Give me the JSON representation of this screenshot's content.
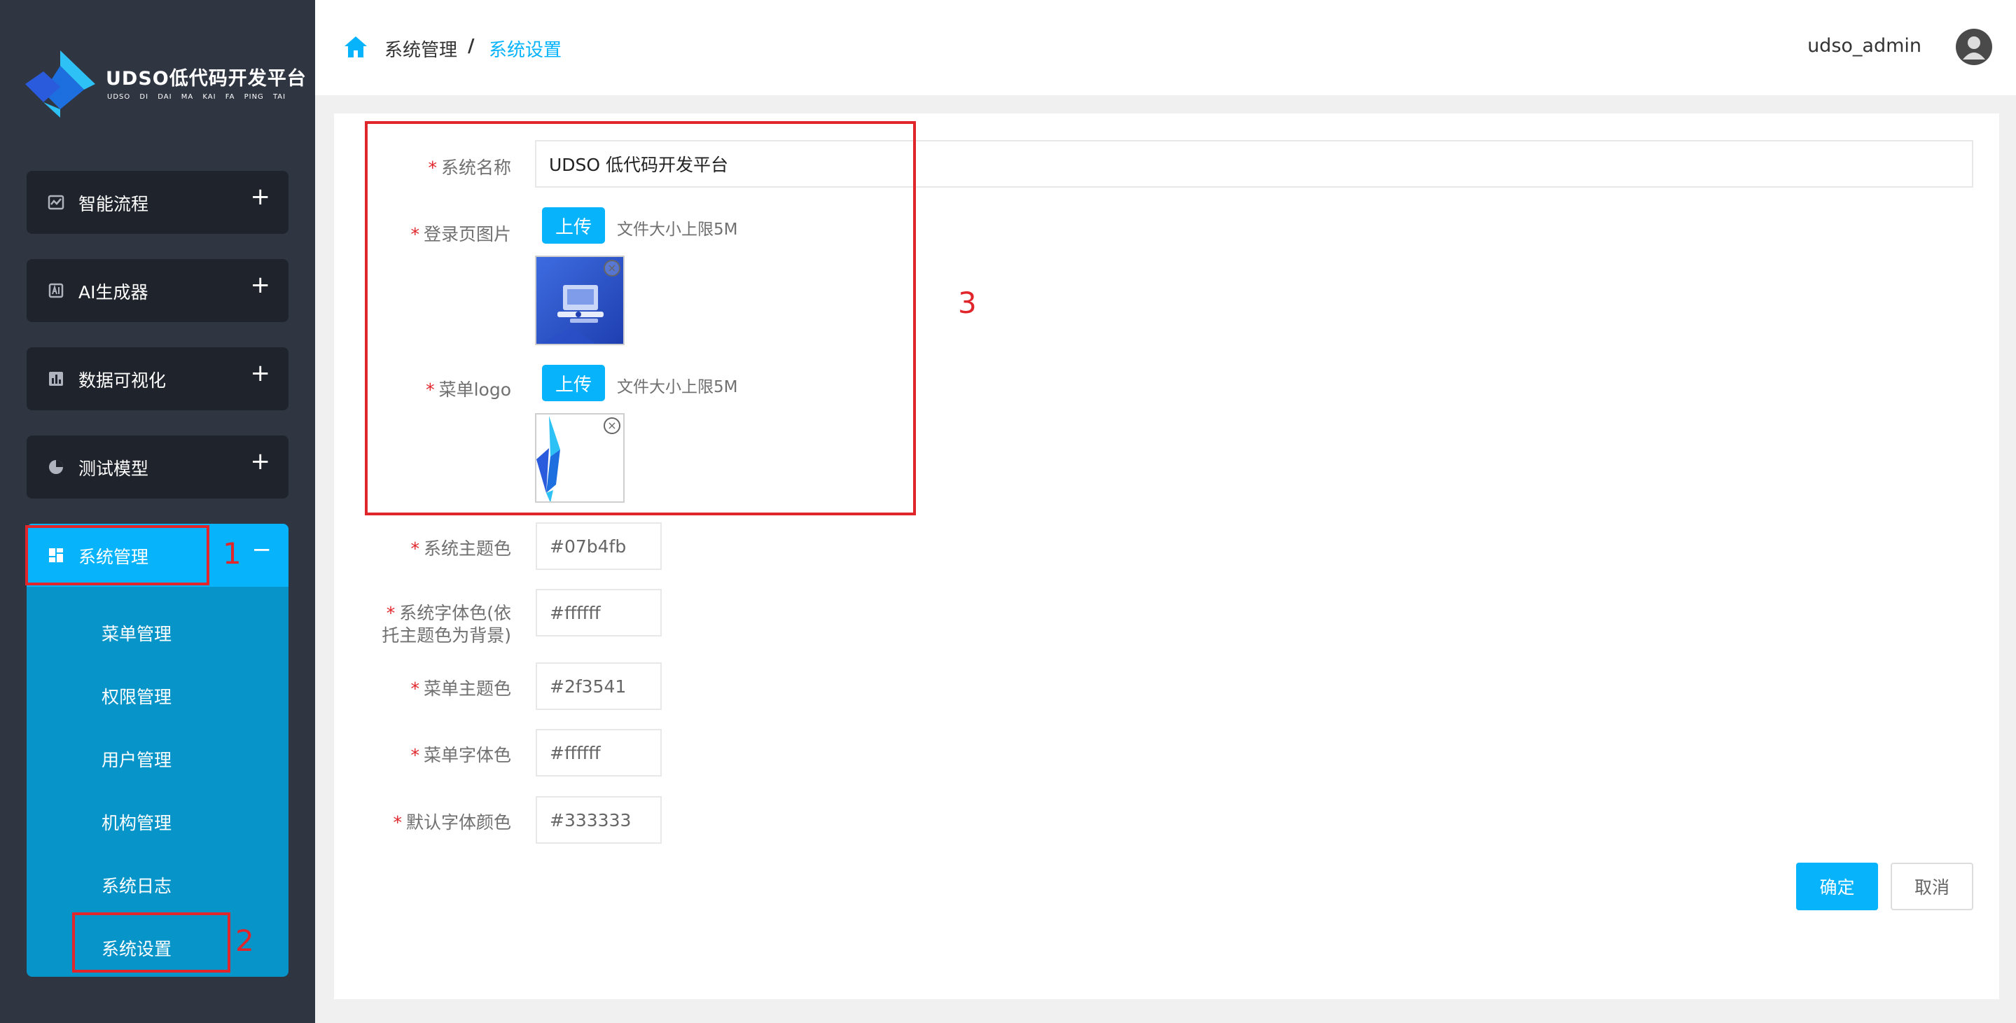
{
  "brand": {
    "title": "UDSO低代码开发平台",
    "subtitle": "UDSO DI DAI MA KAI FA PING TAI"
  },
  "sidebar": {
    "items": [
      {
        "label": "智能流程",
        "icon": "workflow-icon"
      },
      {
        "label": "AI生成器",
        "icon": "ai-generator-icon"
      },
      {
        "label": "数据可视化",
        "icon": "bar-chart-icon"
      },
      {
        "label": "测试模型",
        "icon": "pie-chart-icon"
      }
    ],
    "system": {
      "label": "系统管理",
      "children": [
        "菜单管理",
        "权限管理",
        "用户管理",
        "机构管理",
        "系统日志",
        "系统设置"
      ]
    }
  },
  "annotations": [
    "1",
    "2",
    "3"
  ],
  "header": {
    "breadcrumb": [
      "系统管理",
      "系统设置"
    ],
    "separator": "/",
    "username": "udso_admin"
  },
  "form": {
    "system_name": {
      "label": "系统名称",
      "value": "UDSO 低代码开发平台"
    },
    "login_image": {
      "label": "登录页图片",
      "upload_label": "上传",
      "hint": "文件大小上限5M"
    },
    "menu_logo": {
      "label": "菜单logo",
      "upload_label": "上传",
      "hint": "文件大小上限5M"
    },
    "colors": [
      {
        "label": "系统主题色",
        "value": "#07b4fb"
      },
      {
        "label": "系统字体色(依托主题色为背景)",
        "value": "#ffffff"
      },
      {
        "label": "菜单主题色",
        "value": "#2f3541"
      },
      {
        "label": "菜单字体色",
        "value": "#ffffff"
      },
      {
        "label": "默认字体颜色",
        "value": "#333333"
      }
    ],
    "confirm_label": "确定",
    "cancel_label": "取消"
  },
  "theme": {
    "accent": "#07b4fb",
    "sidebar_bg": "#2f3541",
    "annotation": "#e0262b"
  }
}
